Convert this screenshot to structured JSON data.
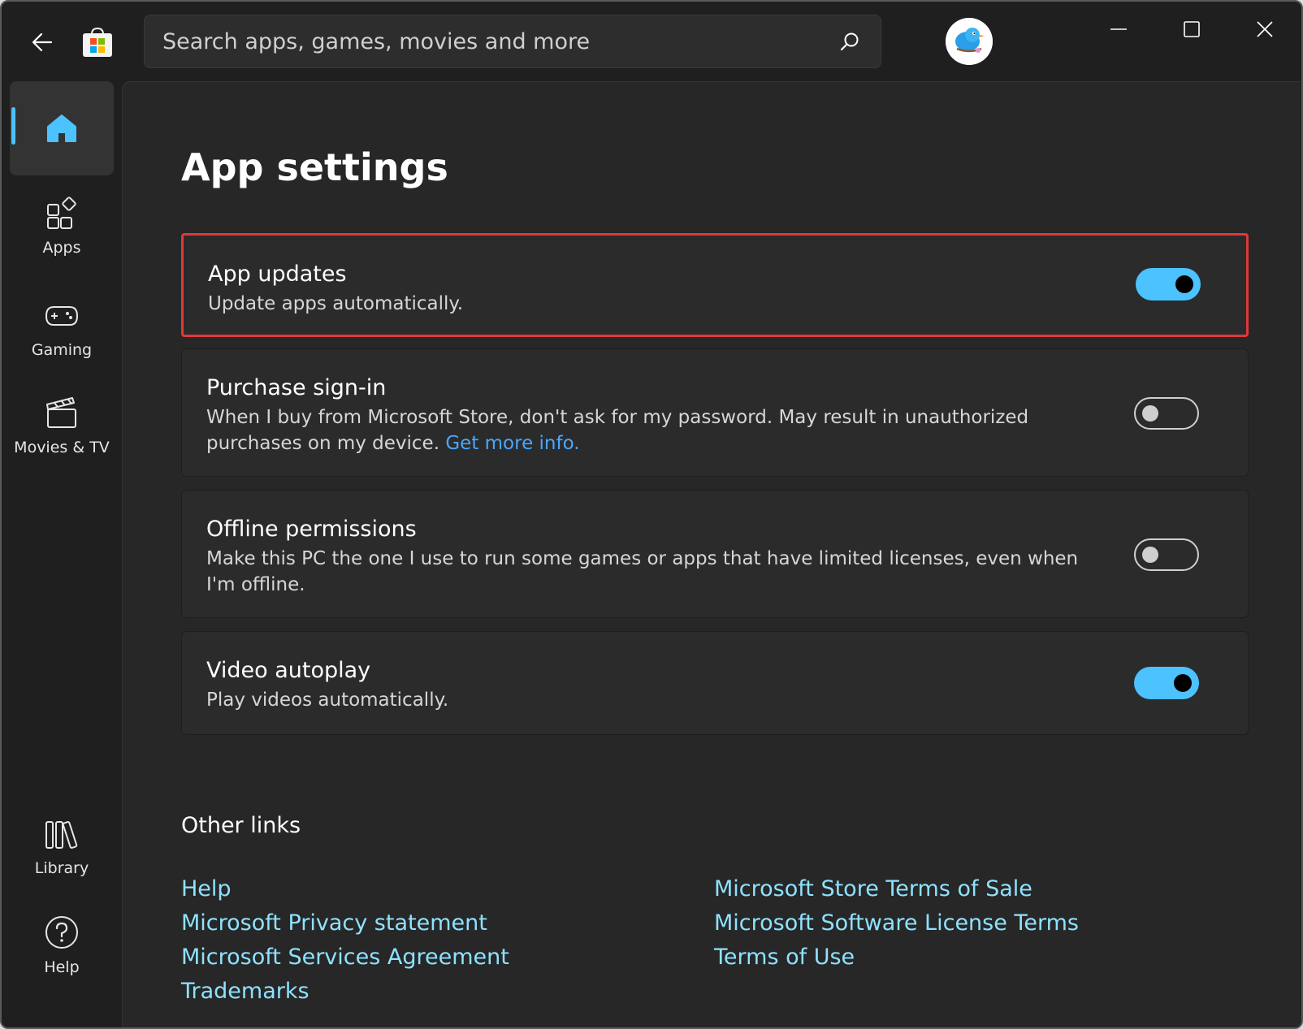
{
  "search": {
    "placeholder": "Search apps, games, movies and more"
  },
  "sidebar": {
    "items": [
      {
        "label": "",
        "icon": "home-icon",
        "selected": true
      },
      {
        "label": "Apps",
        "icon": "apps-icon"
      },
      {
        "label": "Gaming",
        "icon": "gamepad-icon"
      },
      {
        "label": "Movies & TV",
        "icon": "clapperboard-icon"
      },
      {
        "label": "Library",
        "icon": "library-icon"
      },
      {
        "label": "Help",
        "icon": "help-icon"
      }
    ]
  },
  "page": {
    "title": "App settings"
  },
  "settings": [
    {
      "title": "App updates",
      "description": "Update apps automatically.",
      "enabled": true
    },
    {
      "title": "Purchase sign-in",
      "description": "When I buy from Microsoft Store, don't ask for my password. May result in unauthorized purchases on my device.",
      "link": "Get more info.",
      "enabled": false
    },
    {
      "title": "Offline permissions",
      "description": "Make this PC the one I use to run some games or apps that have limited licenses, even when I'm offline.",
      "enabled": false
    },
    {
      "title": "Video autoplay",
      "description": "Play videos automatically.",
      "enabled": true
    }
  ],
  "other_links": {
    "heading": "Other links",
    "left": [
      "Help",
      "Microsoft Privacy statement",
      "Microsoft Services Agreement",
      "Trademarks"
    ],
    "right": [
      "Microsoft Store Terms of Sale",
      "Microsoft Software License Terms",
      "Terms of Use"
    ]
  },
  "colors": {
    "accent": "#4cc2ff",
    "highlight_border": "#e0383b",
    "link": "#8ee2ff",
    "inline_link": "#4aa7ff"
  }
}
